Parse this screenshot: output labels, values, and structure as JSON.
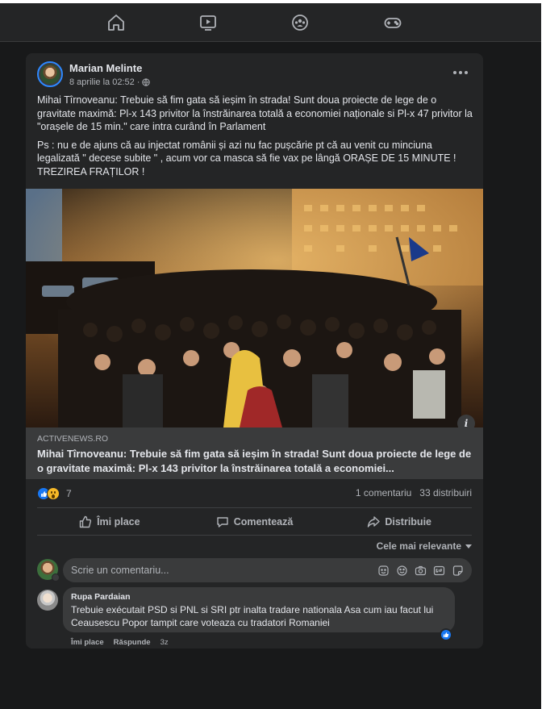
{
  "nav": {
    "icons": [
      "home-icon",
      "watch-icon",
      "groups-icon",
      "gaming-icon"
    ]
  },
  "post": {
    "author": "Marian Melinte",
    "date": "8 aprilie la 02:52",
    "separator": "·",
    "privacy_icon": "globe-icon",
    "text": {
      "p1": "Mihai Tîrnoveanu: Trebuie să fim gata să ieșim în strada! Sunt doua proiecte de lege de o gravitate maximă: Pl-x 143 privitor la înstrăinarea totală a economiei naționale si Pl-x 47 privitor la \"orașele de 15 min.\" care intra curând în Parlament",
      "p2": "Ps : nu e de ajuns că au injectat românii și azi nu fac pușcărie pt că au venit cu minciuna legalizată \" decese subite \" , acum vor ca masca să fie vax pe lângă ORAȘE DE 15 MINUTE !",
      "p3": "TREZIREA FRAȚILOR !"
    },
    "link": {
      "domain": "ACTIVENEWS.RO",
      "title": "Mihai Tîrnoveanu: Trebuie să fim gata să ieșim în strada! Sunt doua proiecte de lege de o gravitate maximă: Pl-x 143 privitor la înstrăinarea totală a economiei..."
    },
    "info_glyph": "i",
    "reactions_count": "7",
    "comments_count": "1 comentariu",
    "shares_count": "33 distribuiri",
    "actions": {
      "like": "Îmi place",
      "comment": "Comentează",
      "share": "Distribuie"
    },
    "sort_label": "Cele mai relevante"
  },
  "composer": {
    "placeholder": "Scrie un comentariu..."
  },
  "comment": {
    "author": "Rupa Pardaian",
    "text": "Trebuie exécutait PSD si PNL si SRI ptr inalta tradare nationala Asa cum iau facut lui Ceausescu Popor tampit care voteaza cu tradatori Romaniei",
    "like_label": "Îmi place",
    "reply_label": "Răspunde",
    "time": "3z"
  },
  "colors": {
    "background": "#18191a",
    "card": "#242526",
    "accent": "#1877f2",
    "text": "#e4e6eb",
    "secondary_text": "#b0b3b8"
  }
}
